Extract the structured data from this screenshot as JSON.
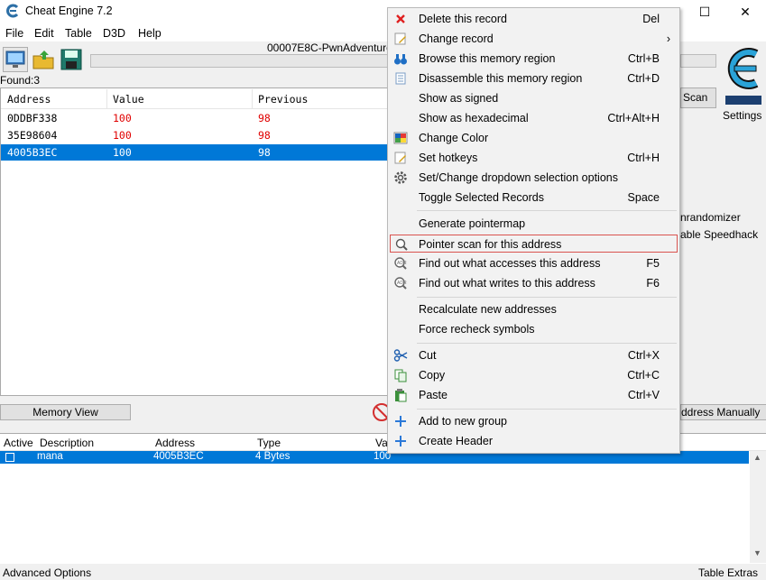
{
  "window": {
    "title": "Cheat Engine 7.2",
    "minimize": "—",
    "maximize": "☐",
    "close": "✕"
  },
  "menu": [
    "File",
    "Edit",
    "Table",
    "D3D",
    "Help"
  ],
  "process_title": "00007E8C-PwnAdventure",
  "found_label": "Found:3",
  "found_list": {
    "columns": [
      "Address",
      "Value",
      "Previous"
    ],
    "rows": [
      {
        "address": "0DDBF338",
        "value": "100",
        "previous": "98"
      },
      {
        "address": "35E98604",
        "value": "100",
        "previous": "98"
      },
      {
        "address": "4005B3EC",
        "value": "100",
        "previous": "98"
      }
    ]
  },
  "right_panel": {
    "scan_button": "Scan",
    "settings": "Settings",
    "unrandomizer": "nrandomizer",
    "speedhack": "able Speedhack",
    "add_manually": "ddress Manually"
  },
  "memory_view": "Memory View",
  "address_table": {
    "columns": [
      "Active",
      "Description",
      "Address",
      "Type",
      "Va"
    ],
    "rows": [
      {
        "description": "mana",
        "address": "4005B3EC",
        "type": "4 Bytes",
        "value": "100"
      }
    ]
  },
  "footer": {
    "left": "Advanced Options",
    "right": "Table Extras"
  },
  "context_menu": {
    "items": [
      {
        "label": "Delete this record",
        "shortcut": "Del",
        "icon": "delete-x-icon"
      },
      {
        "label": "Change record",
        "shortcut": "›",
        "icon": "edit-record-icon"
      },
      {
        "label": "Browse this memory region",
        "shortcut": "Ctrl+B",
        "icon": "binoculars-icon"
      },
      {
        "label": "Disassemble this memory region",
        "shortcut": "Ctrl+D",
        "icon": "disassemble-icon"
      },
      {
        "label": "Show as signed",
        "shortcut": ""
      },
      {
        "label": "Show as hexadecimal",
        "shortcut": "Ctrl+Alt+H"
      },
      {
        "label": "Change Color",
        "shortcut": "",
        "icon": "color-palette-icon"
      },
      {
        "label": "Set hotkeys",
        "shortcut": "Ctrl+H",
        "icon": "hotkey-icon"
      },
      {
        "label": "Set/Change dropdown selection options",
        "shortcut": "",
        "icon": "gear-icon"
      },
      {
        "label": "Toggle Selected Records",
        "shortcut": "Space"
      },
      {
        "label": "Generate pointermap",
        "shortcut": ""
      },
      {
        "label": "Pointer scan for this address",
        "shortcut": "",
        "icon": "magnifier-icon"
      },
      {
        "label": "Find out what accesses this address",
        "shortcut": "F5",
        "icon": "find-access-icon"
      },
      {
        "label": "Find out what writes to this address",
        "shortcut": "F6",
        "icon": "find-write-icon"
      },
      {
        "label": "Recalculate new addresses",
        "shortcut": ""
      },
      {
        "label": "Force recheck symbols",
        "shortcut": ""
      },
      {
        "label": "Cut",
        "shortcut": "Ctrl+X",
        "icon": "scissors-icon"
      },
      {
        "label": "Copy",
        "shortcut": "Ctrl+C",
        "icon": "copy-icon"
      },
      {
        "label": "Paste",
        "shortcut": "Ctrl+V",
        "icon": "paste-icon"
      },
      {
        "label": "Add to new group",
        "shortcut": "",
        "icon": "plus-icon"
      },
      {
        "label": "Create Header",
        "shortcut": "",
        "icon": "plus-icon"
      }
    ],
    "highlighted": "Pointer scan for this address"
  },
  "colors": {
    "selection": "#0078d7",
    "value_red": "#e00000",
    "highlight_border": "#d9534f"
  }
}
